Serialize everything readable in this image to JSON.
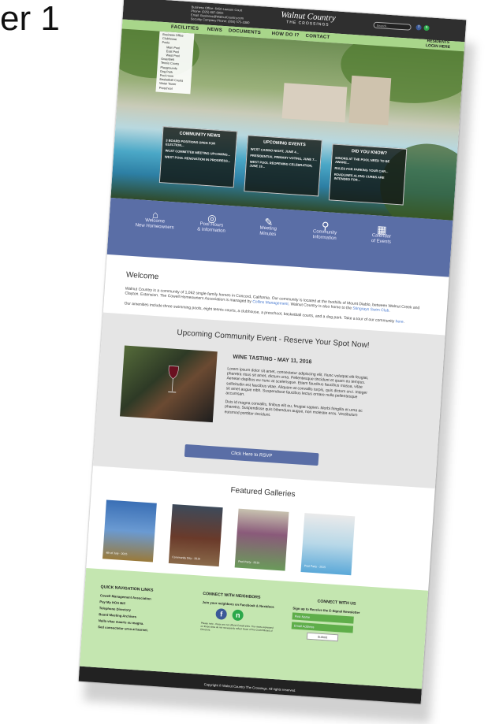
{
  "slide": {
    "title_fragment": "er 1"
  },
  "header": {
    "contact_lines": [
      "Business Office: 6450 Lawson Court",
      "Phone: (925) 687-9955",
      "Email: Business@WalnutCountry.com",
      "Security Company Phone: (855) 575-3380"
    ],
    "brand_name": "Walnut Country",
    "brand_sub": "THE CROSSINGS",
    "search_placeholder": "Search...",
    "social": [
      {
        "name": "facebook-icon",
        "glyph": "f",
        "color": "#3b5998"
      },
      {
        "name": "nextdoor-icon",
        "glyph": "n",
        "color": "#2ba84a"
      }
    ]
  },
  "nav": {
    "items": [
      "FACILITIES",
      "NEWS",
      "DOCUMENTS",
      "HOW DO I?",
      "CONTACT"
    ],
    "residents": "RESIDENTS",
    "login": "LOGIN HERE"
  },
  "submenu": [
    "Business Office",
    "Clubhouse",
    "Pools",
    "Main Pool",
    "East Pool",
    "West Pool",
    "Greenbelt",
    "Tennis Courts",
    "Playgrounds",
    "Dog Park",
    "Pool room",
    "Basketball Courts",
    "Water Tower",
    "Preschool"
  ],
  "news_boxes": [
    {
      "heading": "COMMUNITY NEWS",
      "items": [
        "3 BOARD POSITIONS OPEN FOR ELECTION...",
        "WCST COMMITTEE MEETING UPCOMING...",
        "WEST POOL RENOVATION IN PROGRESS..."
      ]
    },
    {
      "heading": "UPCOMING EVENTS",
      "items": [
        "WCST CASINO NIGHT, JUNE 4...",
        "PRESIDENTIAL PRIMARY VOTING, JUNE 7...",
        "WEST POOL REOPENING CELEBRATION, JUNE 19..."
      ]
    },
    {
      "heading": "DID YOU KNOW?",
      "items": [
        "MINORS AT THE POOL NEED TO BE AWARE...",
        "RULES FOR PARKING YOUR CAR...",
        "ROADLINES ALONG CURBS ARE INTENDED FOR..."
      ]
    }
  ],
  "quick_links": [
    {
      "icon": "house-icon",
      "glyph": "⌂",
      "line1": "Welcome",
      "line2": "New Homeowners"
    },
    {
      "icon": "lifebuoy-icon",
      "glyph": "◎",
      "line1": "Pool Hours",
      "line2": "& Information"
    },
    {
      "icon": "pen-icon",
      "glyph": "✎",
      "line1": "Meeting",
      "line2": "Minutes"
    },
    {
      "icon": "pin-icon",
      "glyph": "⚲",
      "line1": "Community",
      "line2": "Information"
    },
    {
      "icon": "calendar-icon",
      "glyph": "▦",
      "line1": "Calendar",
      "line2": "of Events"
    }
  ],
  "welcome": {
    "title": "Welcome",
    "p1a": "Walnut Country is a community of 1,062 single-family homes in Concord, California. Our community is located at the foothills of Mount Diablo, between Walnut Creek and Clayton. Extension. The Cowell Homeowners Association is managed by ",
    "p1_link": "Collins Management",
    "p1b": ". Walnut Country is also home to the ",
    "p1_link2": "Stingrays Swim Club",
    "p1c": ".",
    "p2a": "Our amenities include three swimming pools, eight tennis courts, a clubhouse, a preschool, basketball courts, and a dog park. Take a tour of our community ",
    "p2_link": "here",
    "p2b": "."
  },
  "event": {
    "heading": "Upcoming Community Event - Reserve Your Spot Now!",
    "title": "WINE TASTING - MAY 11, 2016",
    "p1": "Lorem ipsum dolor sit amet, consectetur adipiscing elit. Nunc volutpat elit feugiat, pharetra risus sit amet, dictum urna. Pellentesque tincidunt et quam eu tempus. Aenean dapibus eu nunc at scelerisque. Etiam faucibus faucibus massa, vitae sollicitudin est faucibus vitae. Aliquam at convallis turpis, quis dictum orci. Integer sit amet augue nibh. Suspendisse faucibus lectus ornare nulla pellentesque accumsan.",
    "p2": "Duis id magna convallis, finibus elit eu, feugiat sapien. Morbi fringilla et urna ac pharetra. Suspendisse quis bibendum augue, non molestie eros. Vestibulum euismod porttitor tincidunt.",
    "button": "Click Here to RSVP"
  },
  "galleries": {
    "heading": "Featured Galleries",
    "items": [
      {
        "caption": "4th of July - 2015",
        "bg": "linear-gradient(180deg,#3a6fb5,#6a9ad2 50%,#9a7a3a)"
      },
      {
        "caption": "Community Day - 2015",
        "bg": "linear-gradient(180deg,#3d4a5a,#6a3a2a 55%,#8a6a4a)"
      },
      {
        "caption": "Pool Party - 2015",
        "bg": "linear-gradient(180deg,#c8c2b0,#8a5a7a 40%,#6a9a5a)"
      },
      {
        "caption": "Pool Party - 2015",
        "bg": "linear-gradient(180deg,#eaeaea,#b8d8e8 50%,#5aa8d8)"
      }
    ]
  },
  "footer": {
    "quick_nav_heading": "QUICK NAVIGATION LINKS",
    "quick_nav": [
      "Cowell Management Association",
      "Pay My HOA Bill",
      "Telephone Directory",
      "Board Meeting Archives",
      "Nulla vitae mauris eu magna.",
      "Sed consectetur urna at laoreet."
    ],
    "connect_heading": "CONNECT WITH NEIGHBORS",
    "connect_text": "Join your neighbors on Facebook & Nextdoor.",
    "disclaimer": "Please note - these are not official Cowell sites. The views expressed on these sites do not necessarily reflect those of the Cowell Board of Directors.",
    "us_heading": "CONNECT WITH US",
    "signup": "Sign up to Receive the E-Signal Newsletter",
    "first_name_placeholder": "First Name",
    "email_placeholder": "Email Address",
    "submit": "Submit",
    "copyright": "Copyright © Walnut Country The Crossings. All rights reserved."
  }
}
